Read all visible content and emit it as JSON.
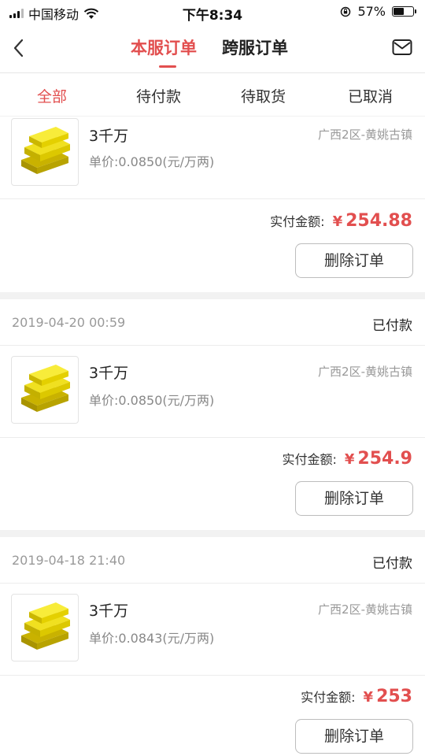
{
  "status_bar": {
    "carrier": "中国移动",
    "time": "下午8:34",
    "battery_percent": "57%",
    "battery_level": 0.57
  },
  "nav": {
    "tabs": [
      {
        "label": "本服订单",
        "active": true
      },
      {
        "label": "跨服订单",
        "active": false
      }
    ],
    "icons": {
      "back": "chevron-left-icon",
      "mail": "envelope-icon"
    }
  },
  "filter_tabs": [
    {
      "label": "全部",
      "active": true
    },
    {
      "label": "待付款",
      "active": false
    },
    {
      "label": "待取货",
      "active": false
    },
    {
      "label": "已取消",
      "active": false
    }
  ],
  "orders": [
    {
      "date": "",
      "status": "",
      "item_name": "3千万",
      "unit_price": "单价:0.0850(元/万两)",
      "server": "广西2区-黄姚古镇",
      "pay_label": "实付金额:",
      "currency": "¥",
      "amount": "254.88",
      "delete_label": "删除订单"
    },
    {
      "date": "2019-04-20 00:59",
      "status": "已付款",
      "item_name": "3千万",
      "unit_price": "单价:0.0850(元/万两)",
      "server": "广西2区-黄姚古镇",
      "pay_label": "实付金额:",
      "currency": "¥",
      "amount": "254.9",
      "delete_label": "删除订单"
    },
    {
      "date": "2019-04-18 21:40",
      "status": "已付款",
      "item_name": "3千万",
      "unit_price": "单价:0.0843(元/万两)",
      "server": "广西2区-黄姚古镇",
      "pay_label": "实付金额:",
      "currency": "¥",
      "amount": "253",
      "delete_label": "删除订单"
    }
  ],
  "colors": {
    "accent": "#e24f4f",
    "text": "#333333",
    "muted": "#999999",
    "background": "#f2f2f2"
  }
}
